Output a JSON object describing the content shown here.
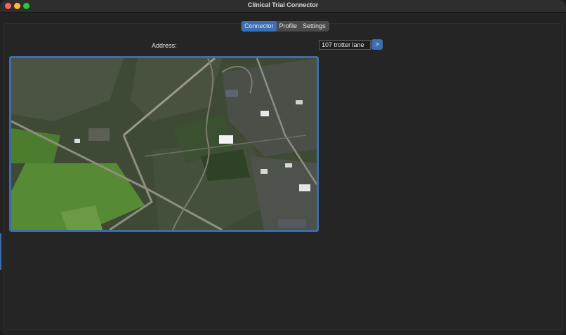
{
  "window": {
    "title": "Clinical Trial Connector"
  },
  "tabs": [
    {
      "label": "Connector",
      "active": true
    },
    {
      "label": "Profile",
      "active": false
    },
    {
      "label": "Settings",
      "active": false
    }
  ],
  "address": {
    "label": "Address:",
    "value": "107 trotter lane",
    "go_label": ">"
  },
  "colors": {
    "accent": "#3a6fb5",
    "window_bg": "#232323"
  }
}
